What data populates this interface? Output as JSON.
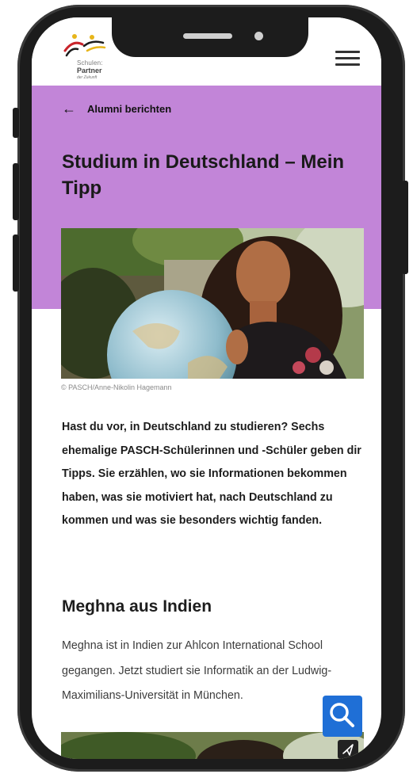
{
  "header": {
    "logo_line1": "Schulen:",
    "logo_line2": "Partner",
    "logo_line3": "der Zukunft",
    "menu_icon": "hamburger-menu-icon"
  },
  "breadcrumb": {
    "arrow": "←",
    "label": "Alumni berichten"
  },
  "article": {
    "title": "Studium in Deutschland – Mein Tipp",
    "photo_credit": "© PASCH/Anne-Nikolin Hagemann",
    "intro": "Hast du vor, in Deutschland zu studieren? Sechs ehemalige PASCH-Schülerinnen und -Schüler geben dir Tipps. Sie erzählen, wo sie Informationen bekommen haben, was sie motiviert hat, nach Deutschland zu kommen und was sie besonders wichtig fanden.",
    "section_heading": "Meghna aus Indien",
    "section_text": "Meghna ist in Indien zur Ahlcon International School gegangen. Jetzt studiert sie Informatik an der Ludwig-Maximilians-Universität in München."
  },
  "controls": {
    "search_icon": "search-icon",
    "share_icon": "send-icon"
  },
  "colors": {
    "accent_band": "#c285d8",
    "search_button": "#1f6fd6",
    "device_frame": "#1c1c1c"
  }
}
